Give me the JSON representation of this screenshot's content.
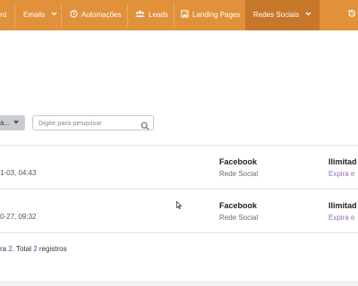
{
  "nav": {
    "items": [
      {
        "label": "rd",
        "icon": ""
      },
      {
        "label": "Emails",
        "icon": ""
      },
      {
        "label": "Automações",
        "icon": "clock-icon"
      },
      {
        "label": "Leads",
        "icon": "users-icon"
      },
      {
        "label": "Landing Pages",
        "icon": "image-icon"
      },
      {
        "label": "Redes Sociais",
        "icon": ""
      }
    ],
    "active_index": 5,
    "history_icon": "history-icon",
    "bar_color": "#e0913a",
    "active_color": "#c7772a"
  },
  "filter": {
    "select_value": "a...",
    "search_placeholder": "Digite para pesquisar"
  },
  "table": {
    "rows": [
      {
        "date": "1-03, 04:43",
        "name": "Facebook",
        "type": "Rede Social",
        "plan": "Ilimitad",
        "expire": "Expira e"
      },
      {
        "date": "0-27, 09:32",
        "name": "Facebook",
        "type": "Rede Social",
        "plan": "Ilimitad",
        "expire": "Expira e"
      }
    ]
  },
  "footer": {
    "prefix": "ra ",
    "page": "2",
    "mid": ". Total ",
    "total": "2",
    "suffix": " registros"
  }
}
